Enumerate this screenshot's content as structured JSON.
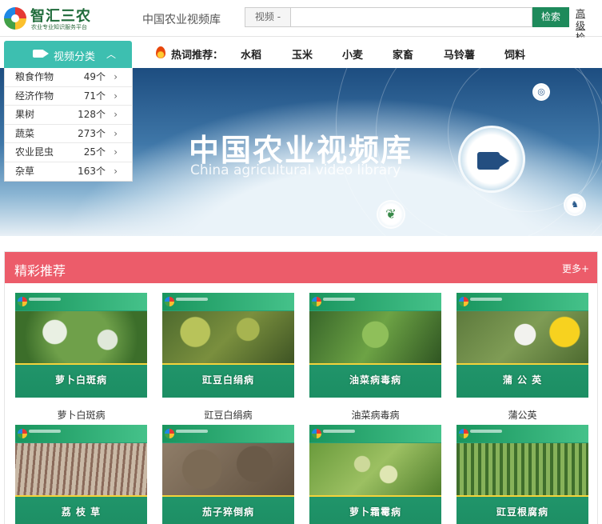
{
  "header": {
    "logo_title": "智汇三农",
    "logo_subtitle": "农业专业知识服务平台",
    "site_name": "中国农业视频库",
    "search_type": "视频 -",
    "search_placeholder": "",
    "search_button": "检索",
    "advanced_search": "高级检索"
  },
  "nav": {
    "category_title": "视频分类",
    "hot_label": "热词推荐：",
    "hot_words": [
      "水稻",
      "玉米",
      "小麦",
      "家畜",
      "马铃薯",
      "饲料"
    ]
  },
  "categories": [
    {
      "name": "粮食作物",
      "count": "49个",
      "arrow": "›"
    },
    {
      "name": "经济作物",
      "count": "71个",
      "arrow": "›"
    },
    {
      "name": "果树",
      "count": "128个",
      "arrow": "›"
    },
    {
      "name": "蔬菜",
      "count": "273个",
      "arrow": "›"
    },
    {
      "name": "农业昆虫",
      "count": "25个",
      "arrow": "›"
    },
    {
      "name": "杂草",
      "count": "163个",
      "arrow": "›"
    }
  ],
  "banner": {
    "title": "中国农业视频库",
    "subtitle": "China agricultural video library"
  },
  "section": {
    "title": "精彩推荐",
    "more": "更多+"
  },
  "videos": [
    {
      "label": "萝卜白斑病",
      "caption": "萝卜白斑病"
    },
    {
      "label": "豇豆白绢病",
      "caption": "豇豆白绢病"
    },
    {
      "label": "油菜病毒病",
      "caption": "油菜病毒病"
    },
    {
      "label": "蒲 公 英",
      "caption": "蒲公英"
    },
    {
      "label": "荔 枝 草",
      "caption": ""
    },
    {
      "label": "茄子猝倒病",
      "caption": ""
    },
    {
      "label": "萝卜霜霉病",
      "caption": ""
    },
    {
      "label": "豇豆根腐病",
      "caption": ""
    }
  ],
  "colors": {
    "brand_green": "#1e8a5b",
    "category_header": "#3dbfb0",
    "section_header": "#ec5c6a",
    "thumb_green": "#2aa37a"
  },
  "icons": {
    "camera": "video-camera-icon",
    "hot": "flame-icon",
    "chevron": "chevron-up-icon"
  }
}
